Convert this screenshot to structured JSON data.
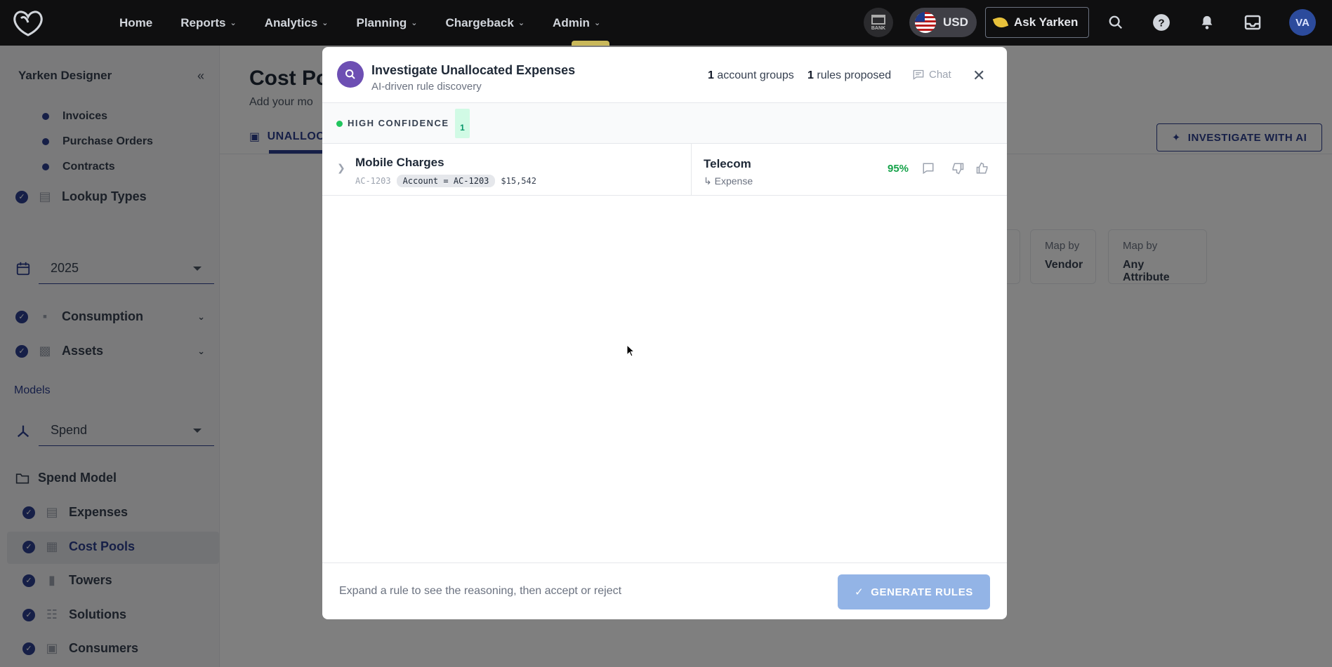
{
  "nav": {
    "items": [
      {
        "label": "Home",
        "dropdown": false
      },
      {
        "label": "Reports",
        "dropdown": true
      },
      {
        "label": "Analytics",
        "dropdown": true
      },
      {
        "label": "Planning",
        "dropdown": true
      },
      {
        "label": "Chargeback",
        "dropdown": true
      },
      {
        "label": "Admin",
        "dropdown": true
      }
    ],
    "bank_label": "BANK",
    "currency": "USD",
    "ask_label": "Ask Yarken",
    "avatar_initials": "VA"
  },
  "sidebar": {
    "title": "Yarken Designer",
    "sub_items": [
      "Invoices",
      "Purchase Orders",
      "Contracts"
    ],
    "lookup_types": "Lookup Types",
    "year": "2025",
    "consumption": "Consumption",
    "assets": "Assets",
    "models_label": "Models",
    "model_select": "Spend",
    "spend_model": "Spend Model",
    "model_items": [
      "Expenses",
      "Cost Pools",
      "Towers",
      "Solutions",
      "Consumers"
    ],
    "active_item": "Cost Pools"
  },
  "main": {
    "title_partial": "Cost Po",
    "subtitle_partial": "Add your mo",
    "tab_partial": "UNALLOC",
    "investigate_button": "INVESTIGATE WITH AI",
    "map_cards": [
      {
        "top": "Map by",
        "bottom": "Vendor"
      },
      {
        "top": "Map by",
        "bottom": "Any Attribute"
      }
    ]
  },
  "modal": {
    "title": "Investigate Unallocated Expenses",
    "subtitle": "AI-driven rule discovery",
    "account_groups_count": "1",
    "account_groups_label": "account groups",
    "rules_count": "1",
    "rules_label": "rules proposed",
    "chat_label": "Chat",
    "confidence_label": "HIGH CONFIDENCE",
    "confidence_count": "1",
    "rule": {
      "name": "Mobile Charges",
      "code": "AC-1203",
      "condition": "Account = AC-1203",
      "amount": "$15,542",
      "target": "Telecom",
      "target_parent": "Expense",
      "confidence": "95%"
    },
    "footer_hint": "Expand a rule to see the reasoning, then accept or reject",
    "generate_label": "GENERATE RULES"
  },
  "colors": {
    "brand": "#2d3f8f",
    "modal_icon": "#6d4fb3",
    "confidence": "#16a34a",
    "generate_button": "#93b4e6"
  }
}
